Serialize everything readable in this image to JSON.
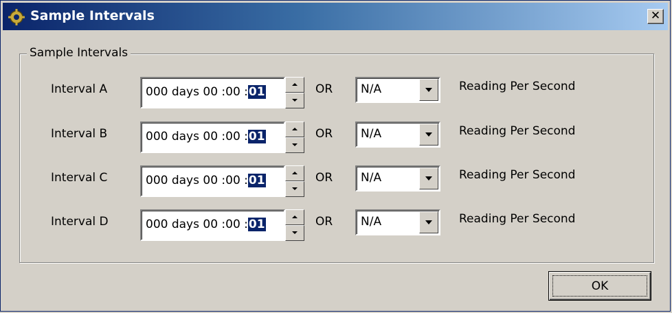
{
  "window": {
    "title": "Sample Intervals",
    "close_glyph": "✕"
  },
  "group": {
    "legend": "Sample Intervals"
  },
  "rows": [
    {
      "label": "Interval A",
      "time_prefix": "000 days 00 :00 :",
      "time_selected": "01",
      "or": "OR",
      "select_value": "N/A",
      "reading": "Reading Per Second"
    },
    {
      "label": "Interval B",
      "time_prefix": "000 days 00 :00 :",
      "time_selected": "01",
      "or": "OR",
      "select_value": "N/A",
      "reading": "Reading Per Second"
    },
    {
      "label": "Interval C",
      "time_prefix": "000 days 00 :00 :",
      "time_selected": "01",
      "or": "OR",
      "select_value": "N/A",
      "reading": "Reading Per Second"
    },
    {
      "label": "Interval D",
      "time_prefix": "000 days 00 :00 :",
      "time_selected": "01",
      "or": "OR",
      "select_value": "N/A",
      "reading": "Reading Per Second"
    }
  ],
  "footer": {
    "ok_label": "OK"
  },
  "colors": {
    "titlebar_start": "#0a246a",
    "titlebar_end": "#a6caf0",
    "face": "#d4d0c8",
    "selection": "#0a246a"
  },
  "icons": {
    "app": "gear-icon",
    "close": "close-icon",
    "spin_up": "triangle-up-icon",
    "spin_down": "triangle-down-icon",
    "dropdown": "chevron-down-icon"
  }
}
